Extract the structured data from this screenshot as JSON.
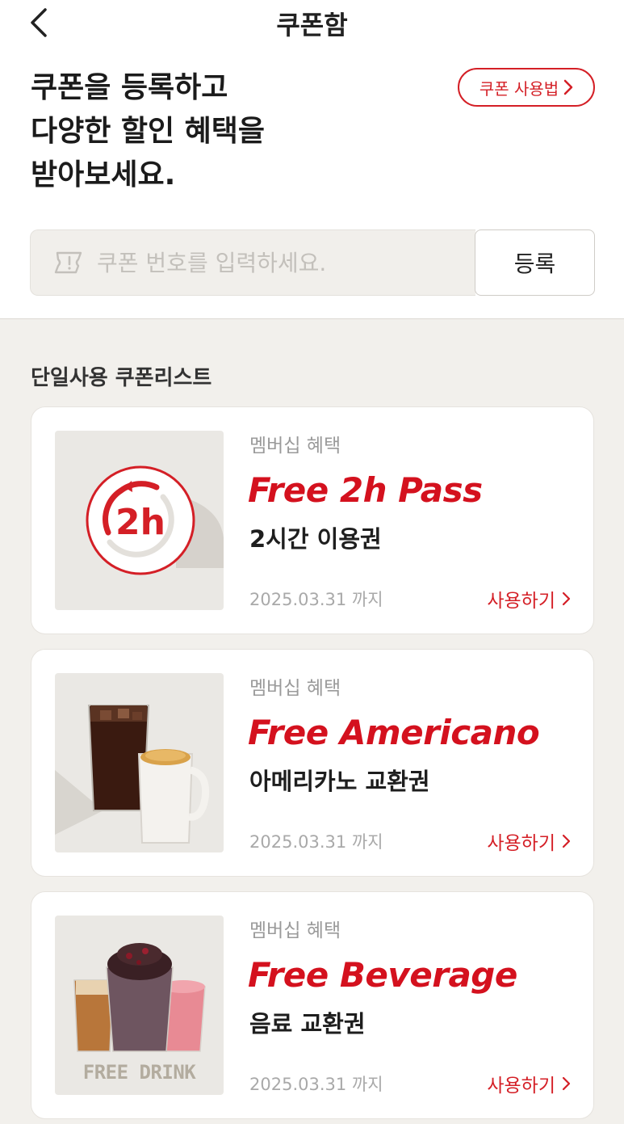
{
  "header": {
    "title": "쿠폰함"
  },
  "hero": {
    "text": "쿠폰을 등록하고\n다양한 할인 혜택을\n받아보세요."
  },
  "guide_button": {
    "label": "쿠폰 사용법"
  },
  "coupon_input": {
    "placeholder": "쿠폰 번호를 입력하세요.",
    "value": ""
  },
  "register_button": {
    "label": "등록"
  },
  "list": {
    "title": "단일사용 쿠폰리스트",
    "cards": [
      {
        "category": "멤버십 혜택",
        "title_en": "Free 2h Pass",
        "title_ko": "2시간 이용권",
        "date": "2025.03.31 까지",
        "use_label": "사용하기",
        "icon": "2h-pass-icon",
        "badge_text": "2h"
      },
      {
        "category": "멤버십 혜택",
        "title_en": "Free Americano",
        "title_ko": "아메리카노 교환권",
        "date": "2025.03.31 까지",
        "use_label": "사용하기",
        "icon": "coffee-icon"
      },
      {
        "category": "멤버십 혜택",
        "title_en": "Free Beverage",
        "title_ko": "음료 교환권",
        "date": "2025.03.31 까지",
        "use_label": "사용하기",
        "icon": "beverage-icon",
        "image_text": "FREE DRINK"
      }
    ]
  },
  "colors": {
    "accent": "#d41f26",
    "background": "#f2f0ec"
  }
}
